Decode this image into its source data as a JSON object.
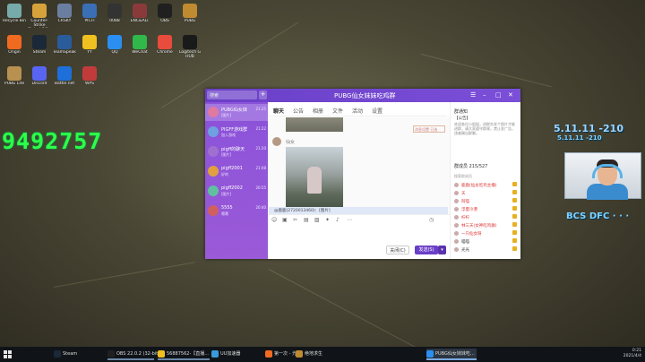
{
  "desktop": {
    "overlay_number": "9492757",
    "overlay_right_top": "5.11.11 -210",
    "overlay_right_mid": "5.11.11 -210",
    "overlay_bottom": "BCS DFC · · ·",
    "icons": [
      {
        "label": "Recycle Bin",
        "color": "#7aa"
      },
      {
        "label": "Counter-Strike Global Off...",
        "color": "#d8a23a"
      },
      {
        "label": "CRSKY",
        "color": "#6a7fa0"
      },
      {
        "label": "PICFI",
        "color": "#3a6fb5"
      },
      {
        "label": "0088",
        "color": "#333"
      },
      {
        "label": "ENC&ALT",
        "color": "#8a3a3a"
      },
      {
        "label": "OBS",
        "color": "#202020"
      },
      {
        "label": "PUBG",
        "color": "#c08a30"
      },
      {
        "label": "Origin",
        "color": "#f06a20"
      },
      {
        "label": "Steam",
        "color": "#1b2838"
      },
      {
        "label": "TeamSpeak",
        "color": "#2a5b9b"
      },
      {
        "label": "YY",
        "color": "#f0c020"
      },
      {
        "label": "QQ",
        "color": "#2a8ff0"
      },
      {
        "label": "WeChat",
        "color": "#30b84a"
      },
      {
        "label": "Chrome",
        "color": "#e94b3c"
      },
      {
        "label": "Logitech G HUB",
        "color": "#1a1a1a"
      },
      {
        "label": "PUBG Lite",
        "color": "#b89050"
      },
      {
        "label": "Discord",
        "color": "#5865f2"
      },
      {
        "label": "Battle.net",
        "color": "#1e6fd9"
      },
      {
        "label": "WPS",
        "color": "#c23b3b"
      }
    ]
  },
  "chat_window": {
    "title": "PUBG仙女妹妹吃鸡群",
    "search_placeholder": "搜索",
    "tabs": [
      "聊天",
      "公告",
      "相册",
      "文件",
      "活动",
      "设置"
    ],
    "conversations": [
      {
        "name": "PUBG仙女妹",
        "preview": "[图片]",
        "time": "21:25",
        "color": "#e07aa0"
      },
      {
        "name": "PIGFF游戏群",
        "preview": "加入游戏",
        "time": "21:22",
        "color": "#6fa0e0"
      },
      {
        "name": "pigff的聊天",
        "preview": "[图片]",
        "time": "21:20",
        "color": "#a070d0"
      },
      {
        "name": "pigff2001",
        "preview": "好的",
        "time": "21:08",
        "color": "#e0a040"
      },
      {
        "name": "pigff2002",
        "preview": "[图片]",
        "time": "20:55",
        "color": "#60c0a0"
      },
      {
        "name": "5555",
        "preview": "嗯嗯",
        "time": "20:40",
        "color": "#d06060"
      }
    ],
    "sender_name": "仙女",
    "notice": "消息设置 已选",
    "quote": "@鹿鹿(2720013460)：[图片]",
    "close_button": "关闭(C)",
    "send_button": "发送(S)",
    "send_dropdown": "▾",
    "right_panel": {
      "announcement_title": "群通知",
      "announcement_subtitle": "【公告】",
      "announcement_text": "欢迎各位小姐姐，进群先发个照片才能进群，请大家遵守群规，禁止发广告，违者踢出群聊。",
      "members_header": "群成员 215/527",
      "search_members": "搜索群成员",
      "members": [
        {
          "name": "鹿鹿(仙女吃鸡主播)",
          "color": "#d33"
        },
        {
          "name": "天",
          "color": "#d33"
        },
        {
          "name": "阿喵",
          "color": "#d33"
        },
        {
          "name": "浮夏冷港",
          "color": "#d33"
        },
        {
          "name": "柠柠",
          "color": "#d33"
        },
        {
          "name": "林三天(女神吃鸡群)",
          "color": "#d33"
        },
        {
          "name": "一只仙女呀",
          "color": "#d33"
        },
        {
          "name": "喵喵",
          "color": "#333"
        },
        {
          "name": "光光",
          "color": "#333"
        }
      ]
    }
  },
  "taskbar": {
    "items": [
      {
        "label": "Steam",
        "color": "#1b2838",
        "state": ""
      },
      {
        "label": "OBS 22.0.2 (32-bit...",
        "color": "#202020",
        "state": "open"
      },
      {
        "label": "56887562-【直播...",
        "color": "#f0c020",
        "state": "open"
      },
      {
        "label": "UU加速器",
        "color": "#3a9ad9",
        "state": ""
      },
      {
        "label": "第一次 - 光辉",
        "color": "#f06a20",
        "state": ""
      },
      {
        "label": "绝地求生",
        "color": "#c08a30",
        "state": ""
      },
      {
        "label": "PUBG仙女妹妹吃...",
        "color": "#2a8ff0",
        "state": "active"
      }
    ],
    "time": "0:21",
    "date": "2021/4/4"
  }
}
